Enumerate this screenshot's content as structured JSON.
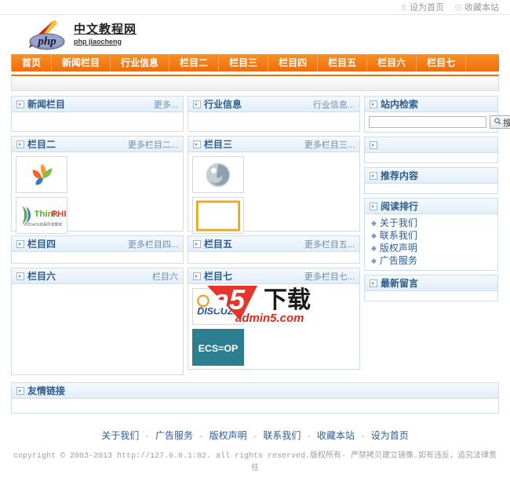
{
  "topbar": {
    "links": [
      {
        "label": "设为首页",
        "icon": "user-icon"
      },
      {
        "label": "收藏本站",
        "icon": "star-circle-icon"
      }
    ]
  },
  "header": {
    "logo": {
      "icon": "php-feather-logo",
      "title_cn": "中文教程网",
      "title_en": "php jiaocheng"
    }
  },
  "nav": {
    "items": [
      {
        "label": "首页"
      },
      {
        "label": "新闻栏目"
      },
      {
        "label": "行业信息"
      },
      {
        "label": "栏目二"
      },
      {
        "label": "栏目三"
      },
      {
        "label": "栏目四"
      },
      {
        "label": "栏目五"
      },
      {
        "label": "栏目六"
      },
      {
        "label": "栏目七"
      }
    ]
  },
  "notice": {
    "text": ""
  },
  "columns": {
    "left": [
      {
        "title": "新闻栏目",
        "more": "更多...",
        "images": []
      },
      {
        "title": "栏目二",
        "more": "更多栏目二...",
        "images": [
          "flower-petal-logo",
          "thinkphp-logo"
        ]
      },
      {
        "title": "栏目四",
        "more": "更多栏目四...",
        "images": []
      },
      {
        "title": "栏目六",
        "more": "栏目六",
        "images": []
      }
    ],
    "middle": [
      {
        "title": "行业信息",
        "more": "行业信息...",
        "images": []
      },
      {
        "title": "栏目三",
        "more": "更多栏目三...",
        "images": [
          "grey-swirl-logo",
          "yellow-box-logo"
        ]
      },
      {
        "title": "栏目五",
        "more": "更多栏目五...",
        "images": []
      },
      {
        "title": "栏目七",
        "more": "更多栏目七...",
        "images": [
          "discuz-logo",
          "ecshop-logo"
        ]
      }
    ],
    "right": [
      {
        "title": "站内检索",
        "type": "search"
      },
      {
        "title": "",
        "type": "empty"
      },
      {
        "title": "推荐内容",
        "type": "empty"
      },
      {
        "title": "阅读排行",
        "type": "links"
      },
      {
        "title": "最新留言",
        "type": "empty"
      }
    ]
  },
  "search": {
    "value": "",
    "placeholder": "",
    "button_label": "搜索",
    "button_icon": "magnifier-icon"
  },
  "ranking_links": [
    {
      "label": "关于我们"
    },
    {
      "label": "联系我们"
    },
    {
      "label": "版权声明"
    },
    {
      "label": "广告服务"
    }
  ],
  "friendlinks": {
    "title": "友情链接",
    "more": ""
  },
  "footer": {
    "links": [
      {
        "label": "关于我们"
      },
      {
        "label": "广告服务"
      },
      {
        "label": "版权声明"
      },
      {
        "label": "联系我们"
      },
      {
        "label": "收藏本站"
      },
      {
        "label": "设为首页"
      }
    ],
    "separator": "-",
    "copyright": "copyright © 2003-2013 http://127.0.0.1:82. all rights reserved.版权所有· 严禁拷贝建立镜像.如有违反，追究法律责任"
  },
  "watermark": {
    "main_text": "a5下载",
    "sub_text": "admin5.com"
  },
  "colors": {
    "nav_orange": "#ef6c0b",
    "panel_border": "#cfdcea",
    "panel_title": "#2d5b8e",
    "link_blue": "#2a5c96"
  }
}
